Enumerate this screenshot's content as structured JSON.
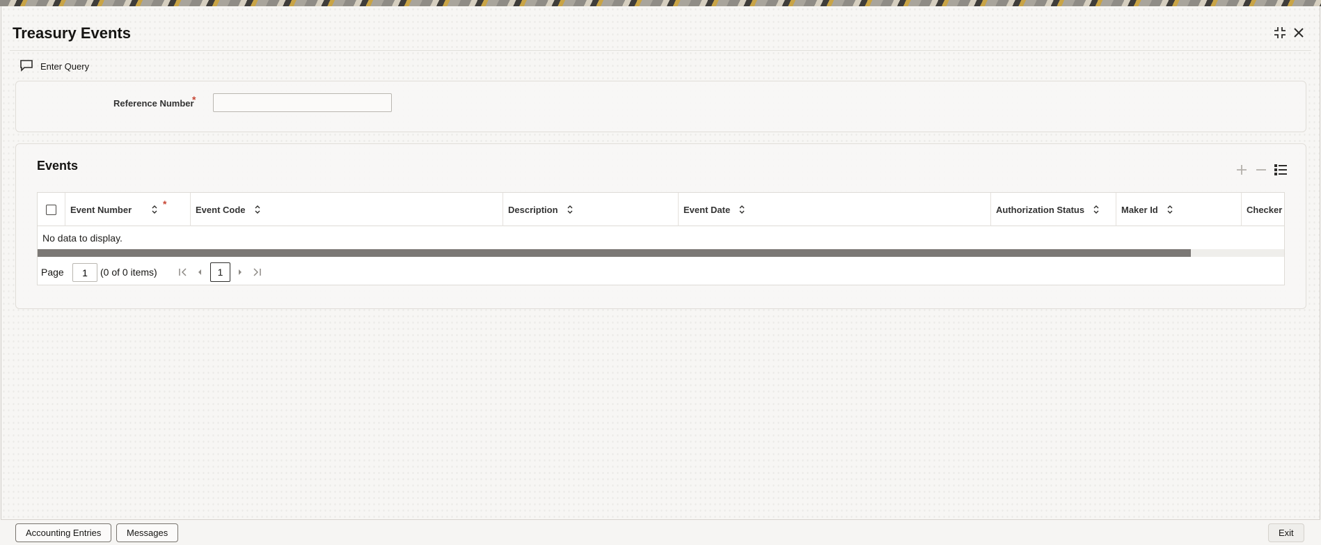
{
  "window": {
    "title": "Treasury Events",
    "restore_icon": "collapse-arrows-icon",
    "close_icon": "close-icon"
  },
  "toolbar": {
    "enter_query_label": "Enter Query",
    "enter_query_icon": "chat-bubble-icon"
  },
  "query_form": {
    "reference_number_label": "Reference Number",
    "required_marker": "*",
    "reference_number_value": ""
  },
  "events": {
    "title": "Events",
    "tools": [
      "add-icon",
      "remove-icon",
      "column-list-icon"
    ],
    "columns": [
      {
        "label": "Event Number",
        "required": true
      },
      {
        "label": "Event Code"
      },
      {
        "label": "Description"
      },
      {
        "label": "Event Date"
      },
      {
        "label": "Authorization Status"
      },
      {
        "label": "Maker Id"
      },
      {
        "label": "Checker Id"
      }
    ],
    "empty_message": "No data to display.",
    "pager": {
      "page_label": "Page",
      "page_value": "1",
      "count_text": "(0 of 0 items)",
      "current_page": "1"
    }
  },
  "footer": {
    "accounting_entries_label": "Accounting Entries",
    "messages_label": "Messages",
    "exit_label": "Exit"
  },
  "colors": {
    "required": "#c74634",
    "scroll_thumb": "#7b7875",
    "text": "#161513"
  }
}
